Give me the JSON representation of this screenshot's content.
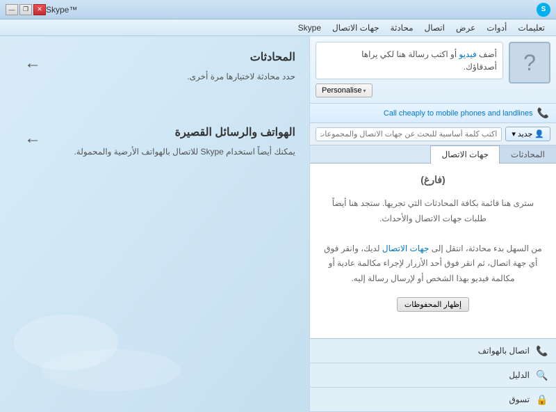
{
  "window": {
    "title": "Skype™",
    "logo_text": "S"
  },
  "title_controls": {
    "minimise": "🗕",
    "restore": "🗗",
    "close": "✕"
  },
  "menu": {
    "items": [
      "تعليمات",
      "أدوات",
      "عرض",
      "اتصال",
      "محادثة",
      "جهات الاتصال",
      "Skype"
    ]
  },
  "profile": {
    "avatar_symbol": "?",
    "message_line1": "أضف",
    "message_link": "فيديو",
    "message_line2": "أو اكتب رسالة هنا لكي يراها",
    "message_line3": "أصدقاؤك.",
    "personalise_label": "Personalise",
    "personalise_arrow": "▾"
  },
  "call_cheaply": {
    "text": "Call cheaply to mobile phones and landlines",
    "icon": "📞"
  },
  "search": {
    "new_label": "جديد",
    "new_icon": "👤",
    "placeholder": "اكتب كلمة أساسية للبحث عن جهات الاتصال والمجموعات"
  },
  "tabs": {
    "conversations_label": "المحادثات",
    "contacts_label": "جهات الاتصال"
  },
  "conversations": {
    "empty_title": "(فارغ)",
    "empty_desc1": "ستری هنا قائمة بكافة المحادثات التي تجريها. ستجد هنا أيضاً",
    "empty_desc2": "طلبات جهات الاتصال والأحداث.",
    "empty_desc3": "من السهل بدء محادثة، انتقل إلى",
    "empty_link": "جهات الاتصال",
    "empty_desc4": "لديك، وانقر فوق",
    "empty_desc5": "أي جهة اتصال، ثم انقر فوق أحد الأزرار لإجراء مكالمة عادية أو",
    "empty_desc6": "مكالمة فيديو بهذا الشخص أو لإرسال رسالة إليه.",
    "show_archived_label": "إظهار المحفوظات"
  },
  "bottom_nav": {
    "items": [
      {
        "label": "اتصال بالهواتف",
        "icon": "📞"
      },
      {
        "label": "الدليل",
        "icon": "🔍"
      },
      {
        "label": "تسوق",
        "icon": "🔒"
      }
    ]
  },
  "right_panel": {
    "section1": {
      "title": "المحادثات",
      "desc": "حدد محادثة لاختيارها مرة أخرى.",
      "arrow": "←"
    },
    "section2": {
      "title": "الهواتف والرسائل القصيرة",
      "desc": "يمكنك أيضاً استخدام Skype للاتصال بالهواتف الأرضية والمحمولة.",
      "arrow": "←"
    }
  }
}
